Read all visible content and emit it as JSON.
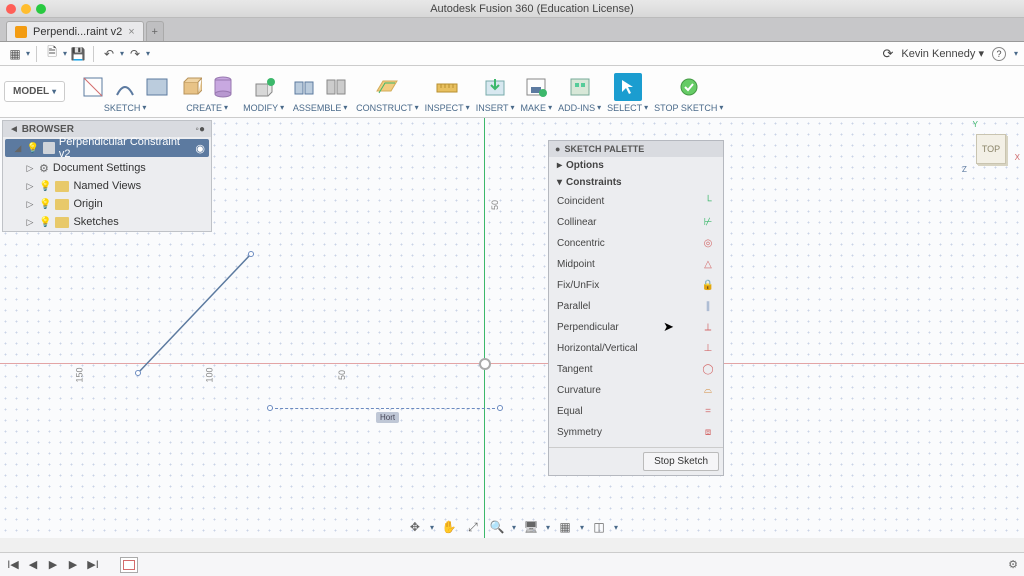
{
  "app": {
    "title": "Autodesk Fusion 360 (Education License)"
  },
  "tab": {
    "name": "Perpendi...raint v2"
  },
  "user": {
    "name": "Kevin Kennedy"
  },
  "workspace": {
    "label": "MODEL"
  },
  "ribbon": {
    "sketch": "SKETCH",
    "create": "CREATE",
    "modify": "MODIFY",
    "assemble": "ASSEMBLE",
    "construct": "CONSTRUCT",
    "inspect": "INSPECT",
    "insert": "INSERT",
    "make": "MAKE",
    "addins": "ADD-INS",
    "select": "SELECT",
    "stopsketch": "STOP SKETCH"
  },
  "browser": {
    "title": "BROWSER",
    "root": "Perpendicular Constraint v2",
    "items": [
      {
        "label": "Document Settings",
        "icon": "gear"
      },
      {
        "label": "Named Views",
        "icon": "folder"
      },
      {
        "label": "Origin",
        "icon": "folder"
      },
      {
        "label": "Sketches",
        "icon": "folder"
      }
    ]
  },
  "axis_ticks": [
    "150",
    "100",
    "50",
    "50"
  ],
  "hline_badge": "Hort",
  "palette": {
    "title": "SKETCH PALETTE",
    "options": "Options",
    "constraints": "Constraints",
    "rows": [
      {
        "label": "Coincident",
        "color": "#3cb86b",
        "glyph": "└"
      },
      {
        "label": "Collinear",
        "color": "#3cb86b",
        "glyph": "⊬"
      },
      {
        "label": "Concentric",
        "color": "#d46b6b",
        "glyph": "◎"
      },
      {
        "label": "Midpoint",
        "color": "#d46b6b",
        "glyph": "△"
      },
      {
        "label": "Fix/UnFix",
        "color": "#d48b3b",
        "glyph": "🔒"
      },
      {
        "label": "Parallel",
        "color": "#8aa0c4",
        "glyph": "∥"
      },
      {
        "label": "Perpendicular",
        "color": "#d46b6b",
        "glyph": "⟂"
      },
      {
        "label": "Horizontal/Vertical",
        "color": "#d46b6b",
        "glyph": "⊥"
      },
      {
        "label": "Tangent",
        "color": "#d46b6b",
        "glyph": "◯"
      },
      {
        "label": "Curvature",
        "color": "#d48b3b",
        "glyph": "⌓"
      },
      {
        "label": "Equal",
        "color": "#d46b6b",
        "glyph": "="
      },
      {
        "label": "Symmetry",
        "color": "#d46b6b",
        "glyph": "⧈"
      }
    ],
    "stop": "Stop Sketch"
  },
  "viewcube": {
    "face": "TOP"
  }
}
